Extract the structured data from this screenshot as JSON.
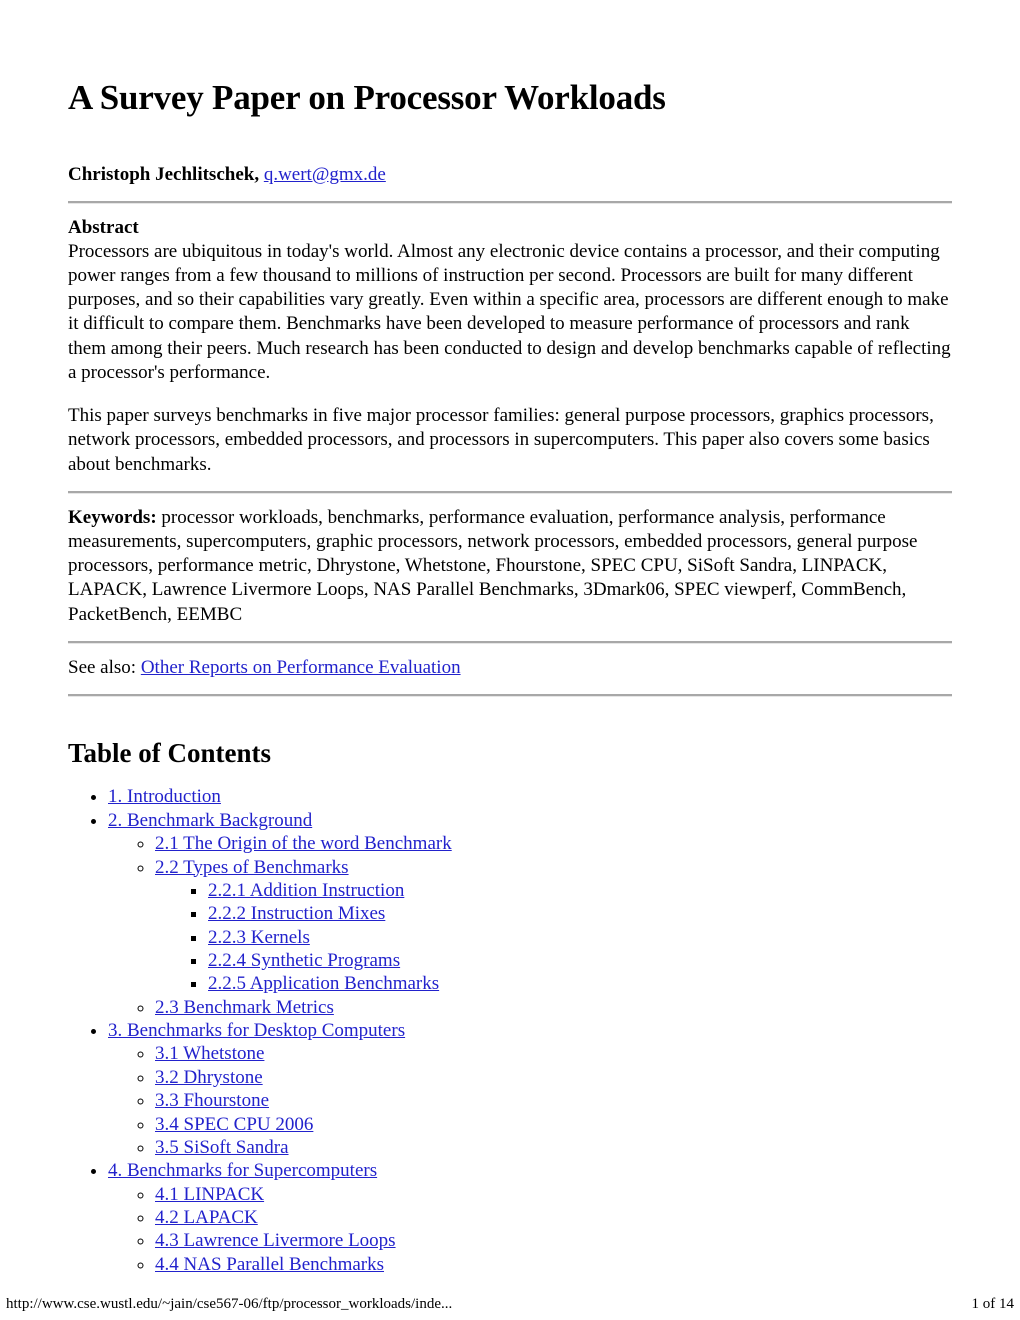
{
  "document": {
    "title": "A Survey Paper on Processor Workloads",
    "author_name": "Christoph Jechlitschek,",
    "author_email": "q.wert@gmx.de"
  },
  "abstract": {
    "label": "Abstract",
    "paragraph1": "Processors are ubiquitous in today's world. Almost any electronic device contains a processor, and their computing power ranges from a few thousand to millions of instruction per second. Processors are built for many different purposes, and so their capabilities vary greatly. Even within a specific area, processors are different enough to make it difficult to compare them. Benchmarks have been developed to measure performance of processors and rank them among their peers. Much research has been conducted to design and develop benchmarks capable of reflecting a processor's performance.",
    "paragraph2": "This paper surveys benchmarks in five major processor families: general purpose processors, graphics processors, network processors, embedded processors, and processors in supercomputers. This paper also covers some basics about benchmarks."
  },
  "keywords": {
    "label": "Keywords:",
    "text": " processor workloads, benchmarks, performance evaluation, performance analysis, performance measurements, supercomputers, graphic processors, network processors, embedded processors, general purpose processors, performance metric, Dhrystone, Whetstone, Fhourstone, SPEC CPU, SiSoft Sandra, LINPACK, LAPACK, Lawrence Livermore Loops, NAS Parallel Benchmarks, 3Dmark06, SPEC viewperf, CommBench, PacketBench, EEMBC"
  },
  "see_also": {
    "label": "See also: ",
    "link_text": "Other Reports on Performance Evaluation"
  },
  "toc": {
    "title": "Table of Contents",
    "items": [
      {
        "label": "1. Introduction"
      },
      {
        "label": "2. Benchmark Background"
      },
      {
        "label": "2.1 The Origin of the word Benchmark"
      },
      {
        "label": "2.2 Types of Benchmarks"
      },
      {
        "label": "2.2.1 Addition Instruction"
      },
      {
        "label": "2.2.2 Instruction Mixes"
      },
      {
        "label": "2.2.3 Kernels"
      },
      {
        "label": "2.2.4 Synthetic Programs"
      },
      {
        "label": "2.2.5 Application Benchmarks"
      },
      {
        "label": "2.3 Benchmark Metrics"
      },
      {
        "label": "3. Benchmarks for Desktop Computers"
      },
      {
        "label": "3.1 Whetstone"
      },
      {
        "label": "3.2 Dhrystone"
      },
      {
        "label": "3.3 Fhourstone"
      },
      {
        "label": "3.4 SPEC CPU 2006"
      },
      {
        "label": "3.5 SiSoft Sandra"
      },
      {
        "label": "4. Benchmarks for Supercomputers"
      },
      {
        "label": "4.1 LINPACK"
      },
      {
        "label": "4.2 LAPACK"
      },
      {
        "label": "4.3 Lawrence Livermore Loops"
      },
      {
        "label": "4.4 NAS Parallel Benchmarks"
      }
    ]
  },
  "footer": {
    "url": "http://www.cse.wustl.edu/~jain/cse567-06/ftp/processor_workloads/inde...",
    "page_number": "1 of 14"
  },
  "colors": {
    "link": "#2222cc",
    "text": "#000000",
    "rule": "#a8a8a8",
    "background": "#ffffff"
  }
}
